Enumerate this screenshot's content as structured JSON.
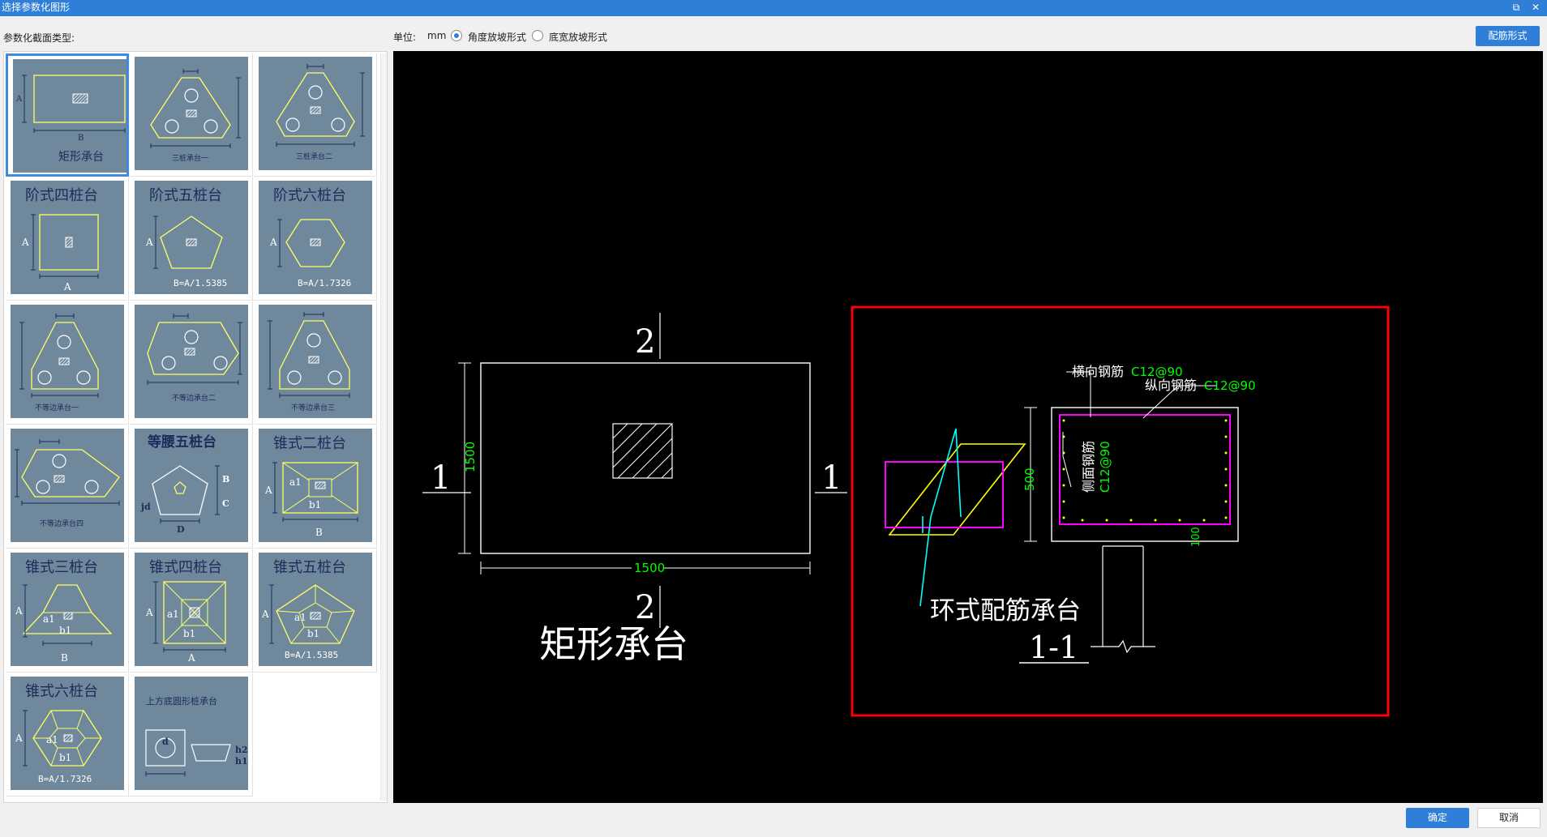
{
  "window": {
    "title": "选择参数化图形",
    "restore_glyph": "⧉",
    "close_glyph": "✕"
  },
  "toolbar": {
    "section_type_label": "参数化截面类型:",
    "unit_label": "单位:",
    "unit_value": "mm",
    "radio_angle": "角度放坡形式",
    "radio_bottom": "底宽放坡形式",
    "rebar_button": "配筋形式"
  },
  "thumbnails": [
    {
      "caption": "矩形承台"
    },
    {
      "caption": "三桩承台一"
    },
    {
      "caption": "三桩承台二"
    },
    {
      "caption": "阶式四桩台"
    },
    {
      "caption": "阶式五桩台",
      "note": "B=A/1.5385"
    },
    {
      "caption": "阶式六桩台",
      "note": "B=A/1.7326"
    },
    {
      "caption": "不等边承台一"
    },
    {
      "caption": "不等边承台二"
    },
    {
      "caption": "不等边承台三"
    },
    {
      "caption": "不等边承台四"
    },
    {
      "caption": "等腰五桩台"
    },
    {
      "caption": "锥式二桩台"
    },
    {
      "caption": "锥式三桩台"
    },
    {
      "caption": "锥式四桩台"
    },
    {
      "caption": "锥式五桩台",
      "note": "B=A/1.5385"
    },
    {
      "caption": "锥式六桩台",
      "note": "B=A/1.7326"
    },
    {
      "caption": "上方底圆形桩承台"
    }
  ],
  "thumb_labels": {
    "A": "A",
    "B": "B",
    "C": "C",
    "D": "D",
    "a1": "a1",
    "b1": "b1",
    "jd": "jd",
    "d": "d",
    "h1": "h1",
    "h2": "h2"
  },
  "preview": {
    "plan_title": "矩形承台",
    "dim_width": "1500",
    "dim_height": "1500",
    "section_mark_top": "2",
    "section_mark_bottom": "2",
    "section_mark_left": "1",
    "section_mark_right": "1",
    "detail_title": "环式配筋承台",
    "section_id": "1-1",
    "rebar_transverse_label": "横向钢筋",
    "rebar_transverse_spec": "C12@90",
    "rebar_longitudinal_label": "纵向钢筋",
    "rebar_longitudinal_spec": "C12@90",
    "rebar_side_label": "侧面钢筋",
    "rebar_side_spec": "C12@90",
    "dim_section_height": "500",
    "dim_cover": "100"
  },
  "colors": {
    "accent": "#2f7fd8",
    "thumb_bg": "#6f889c",
    "cad_yellow": "#ffff00",
    "cad_green": "#00ff00",
    "cad_magenta": "#ff00ff",
    "cad_cyan": "#00ffff",
    "cad_red": "#ff0000"
  },
  "footer": {
    "ok": "确定",
    "cancel": "取消"
  }
}
